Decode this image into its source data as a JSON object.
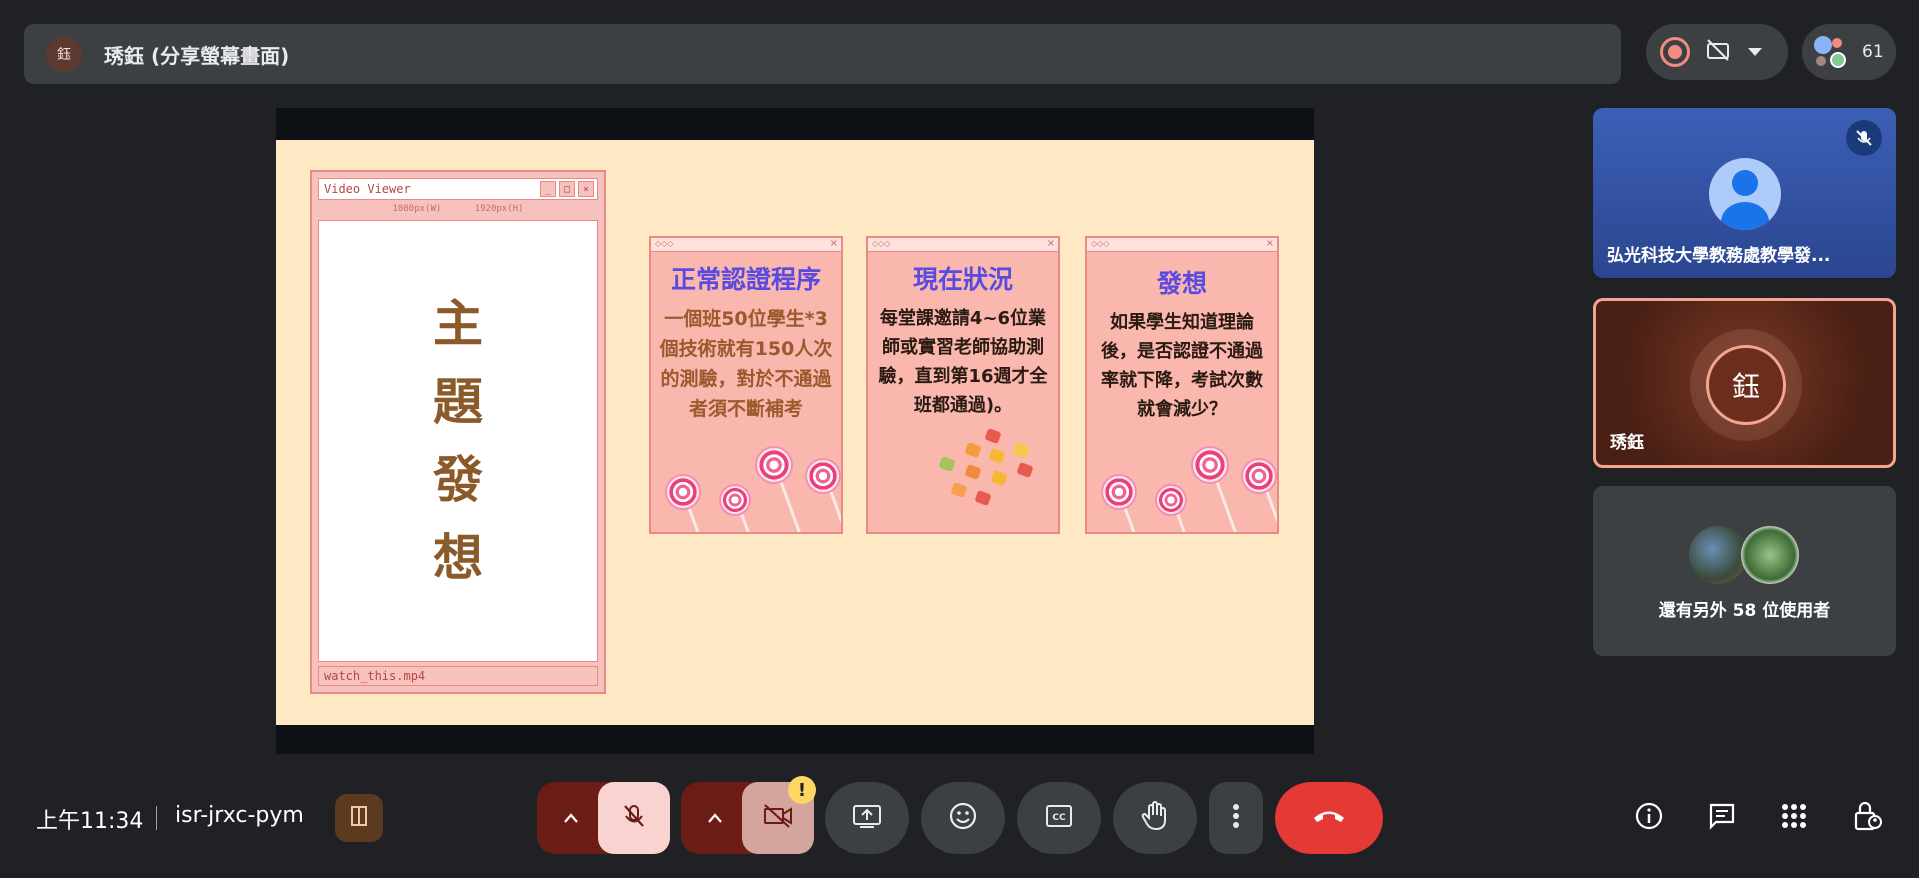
{
  "presenter": {
    "avatar_text": "鈺",
    "label": "琇鈺 (分享螢幕畫面)"
  },
  "top_right": {
    "participant_count": "61"
  },
  "slide": {
    "viewer": {
      "title": "Video Viewer",
      "dims": "1080px(W) 1920px(H)",
      "theme_chars": [
        "主",
        "題",
        "發",
        "想"
      ],
      "filename": "watch_this.mp4"
    },
    "cards": [
      {
        "title": "正常認證程序",
        "body": "一個班50位學生*3個技術就有150人次的測驗，對於不通過者須不斷補考",
        "body_color": "#9a5a2e"
      },
      {
        "title": "現在狀況",
        "body": "每堂課邀請4~6位業師或實習老師協助測驗，直到第16週才全班都通過)。",
        "body_color": "#2b1a12"
      },
      {
        "title": "發想",
        "body": "如果學生知道理論後，是否認證不通過率就下降，考試次數就會減少？",
        "body_color": "#2b1a12"
      }
    ]
  },
  "tiles": {
    "tile1_name": "弘光科技大學教務處教學發...",
    "tile2_avatar": "鈺",
    "tile2_name": "琇鈺",
    "tile3_label": "還有另外 58 位使用者"
  },
  "bottom": {
    "clock": "上午11:34",
    "meeting_code": "isr-jrxc-pym",
    "camera_warning": "!"
  },
  "colors": {
    "leave_call": "#e53935",
    "mic_off_bg": "#f9d3cf",
    "cam_off_bg": "#d4a59f",
    "group_bg": "#6b1d15"
  }
}
